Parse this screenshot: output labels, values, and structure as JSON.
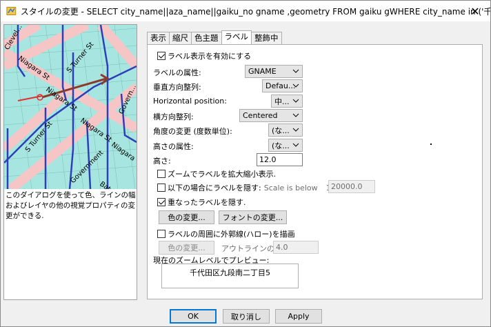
{
  "window": {
    "title": "スタイルの変更 - SELECT city_name||aza_name||gaiku_no gname ,geometry FROM gaiku gWHERE city_name in ('千代田区','..."
  },
  "map_labels": {
    "l1": "Clevel...",
    "l2": "Niagara St",
    "l3": "S Turner St",
    "l4": "Niagara St",
    "l5": "Niagara St",
    "l6": "S Turner St",
    "l7": "Govern...",
    "l8": "Government",
    "l9": "Govern...",
    "l10": "Niagara",
    "l11": "Bat..."
  },
  "description": "このダイアログを使って色、ラインの幅およびレイヤの他の視覚プロパティの変更ができる.",
  "tabs": [
    {
      "label": "表示",
      "active": false
    },
    {
      "label": "縮尺",
      "active": false
    },
    {
      "label": "色主題",
      "active": false
    },
    {
      "label": "ラベル",
      "active": true
    },
    {
      "label": "整飾中",
      "active": false
    }
  ],
  "label_tab": {
    "enable_label": {
      "label": "ラベル表示を有効にする",
      "checked": true
    },
    "label_attr": {
      "label": "ラベルの属性:",
      "value": "GNAME"
    },
    "vertical_align": {
      "label": "垂直方向整列:",
      "value": "Defau..."
    },
    "horizontal_position": {
      "label": "Horizontal position:",
      "value": "中..."
    },
    "horizontal_align": {
      "label": "横方向整列:",
      "value": "Centered"
    },
    "angle_attr": {
      "label": "角度の変更 (度数単位):",
      "value": "(な..."
    },
    "height_attr": {
      "label": "高さの属性:",
      "value": "(な..."
    },
    "height": {
      "label": "高さ:",
      "value": "12.0"
    },
    "zoom_scale": {
      "label": "ズームでラベルを拡大縮小表示.",
      "checked": false
    },
    "hide_below": {
      "label": "以下の場合にラベルを隠す:",
      "checked": false,
      "scale_label": "Scale is below",
      "scale_prefix": "1:",
      "scale_value": "20000.0"
    },
    "hide_overlap": {
      "label": "重なったラベルを隠す.",
      "checked": true
    },
    "color_button": "色の変更...",
    "font_button": "フォントの変更...",
    "halo": {
      "label": "ラベルの周囲に外郭線(ハロー)を描画",
      "checked": false
    },
    "halo_color_button": "色の変更...",
    "outline_width_label": "アウトラインの幅:",
    "outline_width_value": "4.0",
    "preview_label": "現在のズームレベルでプレビュー:",
    "preview_text": "千代田区九段南二丁目5"
  },
  "footer": {
    "ok": "OK",
    "cancel": "取り消し",
    "apply": "Apply"
  },
  "colors": {
    "map_water": "#a7e6e0",
    "map_road": "#f6c6c6",
    "map_line": "#2d3fb8",
    "map_arrow": "#8c3a2d",
    "accent": "#0078d7"
  }
}
